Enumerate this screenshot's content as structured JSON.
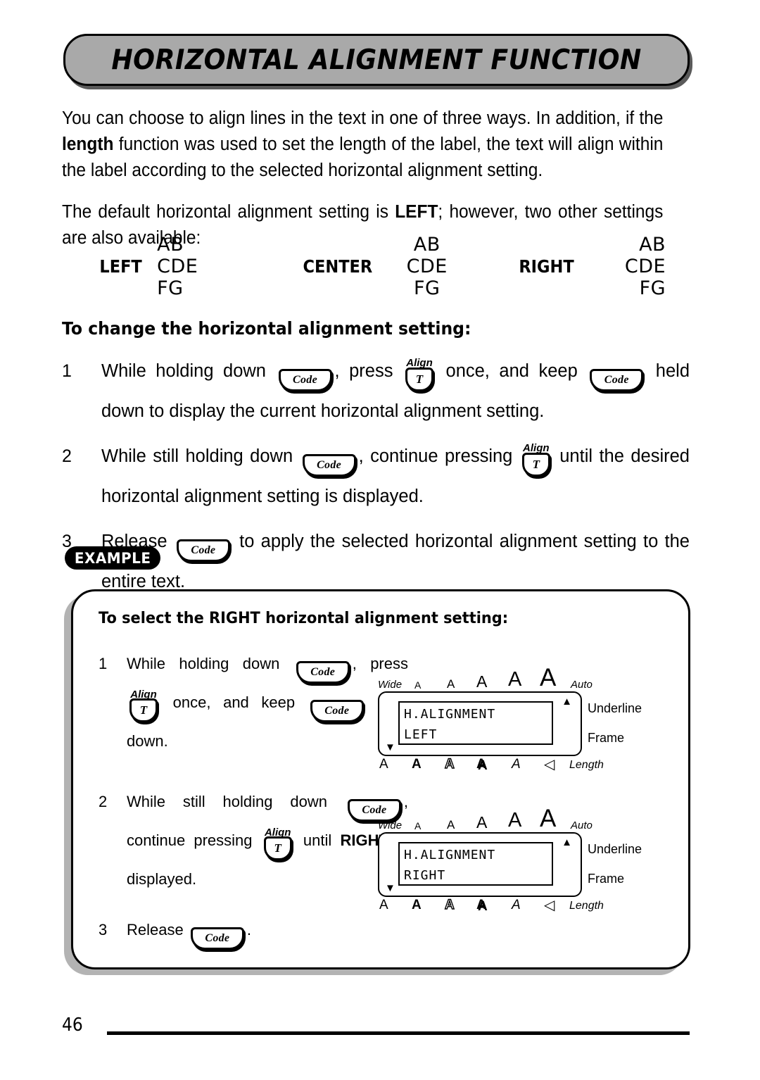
{
  "header": {
    "title": "HORIZONTAL ALIGNMENT FUNCTION"
  },
  "intro": {
    "paragraph_1_before": "You can choose to align lines in the text in one of three ways. In addition, if the ",
    "paragraph_1_bold": "length",
    "paragraph_1_after": " function was used to set the length of the label, the text will align within the label according to the selected horizontal alignment setting.",
    "paragraph_2_before": "The default horizontal alignment setting is ",
    "paragraph_2_bold": "LEFT",
    "paragraph_2_after": "; however, two other settings are also available:"
  },
  "alignment_samples": [
    {
      "label": "LEFT",
      "lines": [
        "AB",
        "CDE",
        "FG"
      ],
      "align": "left"
    },
    {
      "label": "CENTER",
      "lines": [
        "AB",
        "CDE",
        "FG"
      ],
      "align": "center"
    },
    {
      "label": "RIGHT",
      "lines": [
        "AB",
        "CDE",
        "FG"
      ],
      "align": "right"
    }
  ],
  "procedure": {
    "heading": "To change the horizontal alignment setting:",
    "steps": [
      {
        "number": "1",
        "t1": "While holding down ",
        "key1": "Code",
        "t2": ", press ",
        "key2": "T",
        "key2_sup": "Align",
        "t3": " once, and keep ",
        "key3": "Code",
        "t4": " held down to display the current horizontal alignment setting."
      },
      {
        "number": "2",
        "t1": "While still holding down ",
        "key1": "Code",
        "t2": ", continue pressing ",
        "key2": "T",
        "key2_sup": "Align",
        "t3": " until the desired horizontal alignment setting is displayed."
      },
      {
        "number": "3",
        "t1": "Release ",
        "key1": "Code",
        "t2": " to apply the selected horizontal alignment setting to the entire text."
      }
    ]
  },
  "example": {
    "badge": "EXAMPLE",
    "title": "To select the RIGHT horizontal alignment setting:",
    "steps": [
      {
        "number": "1",
        "t1": "While holding down ",
        "key1": "Code",
        "t2": ", press ",
        "key2": "T",
        "key2_sup": "Align",
        "t3": " once, and keep ",
        "key3": "Code",
        "t4": " held down."
      },
      {
        "number": "2",
        "t1": "While still holding down ",
        "key1": "Code",
        "t2": ", continue pressing ",
        "key2": "T",
        "key2_sup": "Align",
        "t3": " until ",
        "bold1": "RIGHT",
        "t4": " is displayed."
      },
      {
        "number": "3",
        "t1": "Release ",
        "key1": "Code",
        "t2": "."
      }
    ],
    "displays": [
      {
        "line1": "H.ALIGNMENT",
        "line2": "LEFT",
        "top_labels": {
          "left": "Wide",
          "right": "Auto"
        },
        "top_sizes": [
          "A",
          "A",
          "A",
          "A",
          "A"
        ],
        "right_labels": [
          "Underline",
          "Frame"
        ],
        "bottom_glyphs": [
          "A",
          "A",
          "A",
          "A",
          "A",
          "◁"
        ],
        "bottom_label": "Length",
        "marker_up": "▲",
        "marker_down": "▼"
      },
      {
        "line1": "H.ALIGNMENT",
        "line2": "RIGHT",
        "top_labels": {
          "left": "Wide",
          "right": "Auto"
        },
        "top_sizes": [
          "A",
          "A",
          "A",
          "A",
          "A"
        ],
        "right_labels": [
          "Underline",
          "Frame"
        ],
        "bottom_glyphs": [
          "A",
          "A",
          "A",
          "A",
          "A",
          "◁"
        ],
        "bottom_label": "Length",
        "marker_up": "▲",
        "marker_down": "▼"
      }
    ]
  },
  "footer": {
    "page_number": "46"
  }
}
